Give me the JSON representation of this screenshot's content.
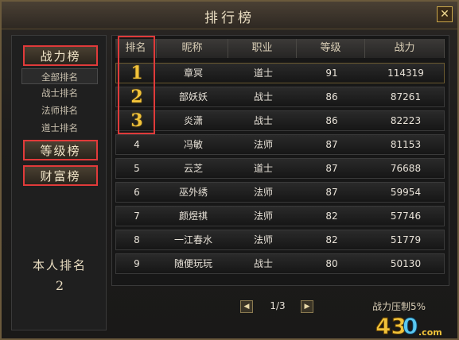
{
  "window": {
    "title": "排行榜",
    "close_label": "✕"
  },
  "sidebar": {
    "tabs": [
      {
        "label": "战力榜",
        "selected": true
      },
      {
        "label": "等级榜",
        "selected": false
      },
      {
        "label": "财富榜",
        "selected": false
      }
    ],
    "subitems": [
      "全部排名",
      "战士排名",
      "法师排名",
      "道士排名"
    ],
    "self_rank": {
      "label": "本人排名",
      "value": "2"
    }
  },
  "table": {
    "headers": [
      "排名",
      "昵称",
      "职业",
      "等级",
      "战力"
    ],
    "rows": [
      {
        "rank": "1",
        "name": "章冥",
        "class": "道士",
        "level": "91",
        "power": "114319"
      },
      {
        "rank": "2",
        "name": "部妖妖",
        "class": "战士",
        "level": "86",
        "power": "87261"
      },
      {
        "rank": "3",
        "name": "炎潇",
        "class": "战士",
        "level": "86",
        "power": "82223"
      },
      {
        "rank": "4",
        "name": "冯敏",
        "class": "法师",
        "level": "87",
        "power": "81153"
      },
      {
        "rank": "5",
        "name": "云芝",
        "class": "道士",
        "level": "87",
        "power": "76688"
      },
      {
        "rank": "6",
        "name": "巫外绣",
        "class": "法师",
        "level": "87",
        "power": "59954"
      },
      {
        "rank": "7",
        "name": "颜煜祺",
        "class": "法师",
        "level": "82",
        "power": "57746"
      },
      {
        "rank": "8",
        "name": "一江春水",
        "class": "法师",
        "level": "82",
        "power": "51779"
      },
      {
        "rank": "9",
        "name": "随便玩玩",
        "class": "战士",
        "level": "80",
        "power": "50130"
      }
    ]
  },
  "pager": {
    "prev": "◀",
    "next": "▶",
    "info": "1/3"
  },
  "footer": {
    "note": "战力压制5%"
  },
  "watermark": {
    "text": "430.com"
  },
  "colors": {
    "accent_gold": "#f2c33a",
    "highlight_red": "#e03a3a"
  }
}
